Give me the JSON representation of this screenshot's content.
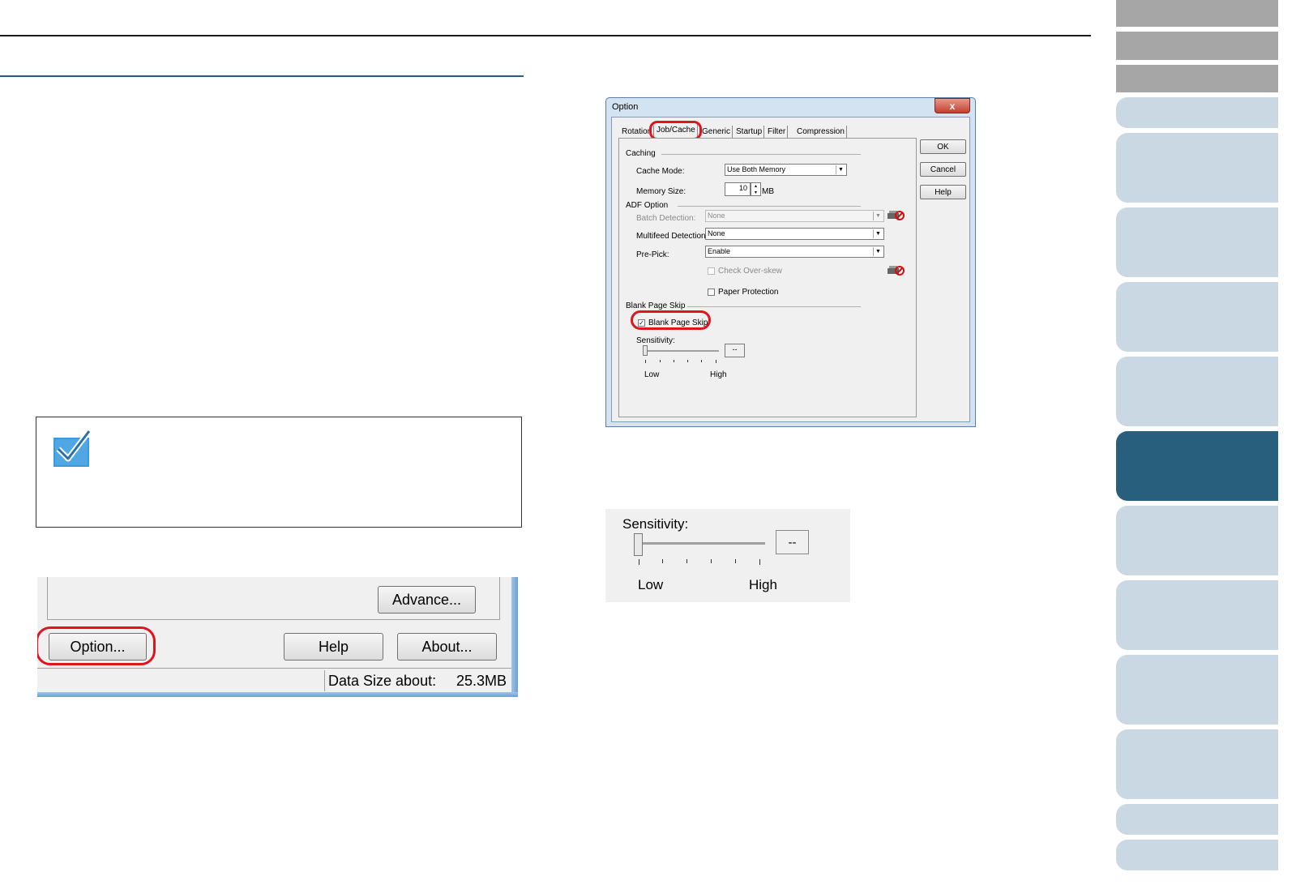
{
  "colors": {
    "nav_active": "#285f7c",
    "nav_light": "#c9d8e3",
    "nav_gray": "#a6a6a6",
    "highlight": "#e0141e",
    "rule": "#2d5a7b"
  },
  "icons": {
    "note": "checkmark-icon",
    "scanner": "scanner-icon"
  },
  "main_window": {
    "advance_button": "Advance...",
    "option_button": "Option...",
    "help_button": "Help",
    "about_button": "About...",
    "status_label": "Data Size about:",
    "status_value": "25.3MB"
  },
  "option_dialog": {
    "title": "Option",
    "close": "x",
    "tabs": [
      {
        "label": "Rotation"
      },
      {
        "label": "Job/Cache"
      },
      {
        "label": "Generic"
      },
      {
        "label": "Startup"
      },
      {
        "label": "Filter"
      },
      {
        "label": "Compression"
      }
    ],
    "buttons": {
      "ok": "OK",
      "cancel": "Cancel",
      "help": "Help"
    },
    "caching": {
      "group": "Caching",
      "cache_mode_label": "Cache Mode:",
      "cache_mode_value": "Use Both Memory",
      "memory_size_label": "Memory Size:",
      "memory_size_value": "10",
      "memory_unit": "MB"
    },
    "adf": {
      "group": "ADF Option",
      "batch_label": "Batch Detection:",
      "batch_value": "None",
      "multifeed_label": "Multifeed Detection:",
      "multifeed_value": "None",
      "prepick_label": "Pre-Pick:",
      "prepick_value": "Enable",
      "check_overskew": "Check Over-skew",
      "paper_protection": "Paper Protection"
    },
    "blank_page": {
      "group": "Blank Page Skip",
      "checkbox_label": "Blank Page Skip",
      "checked": true,
      "sensitivity_label": "Sensitivity:",
      "sensitivity_value": "--",
      "low": "Low",
      "high": "High"
    }
  },
  "sensitivity_zoom": {
    "label": "Sensitivity:",
    "value": "--",
    "low": "Low",
    "high": "High"
  }
}
